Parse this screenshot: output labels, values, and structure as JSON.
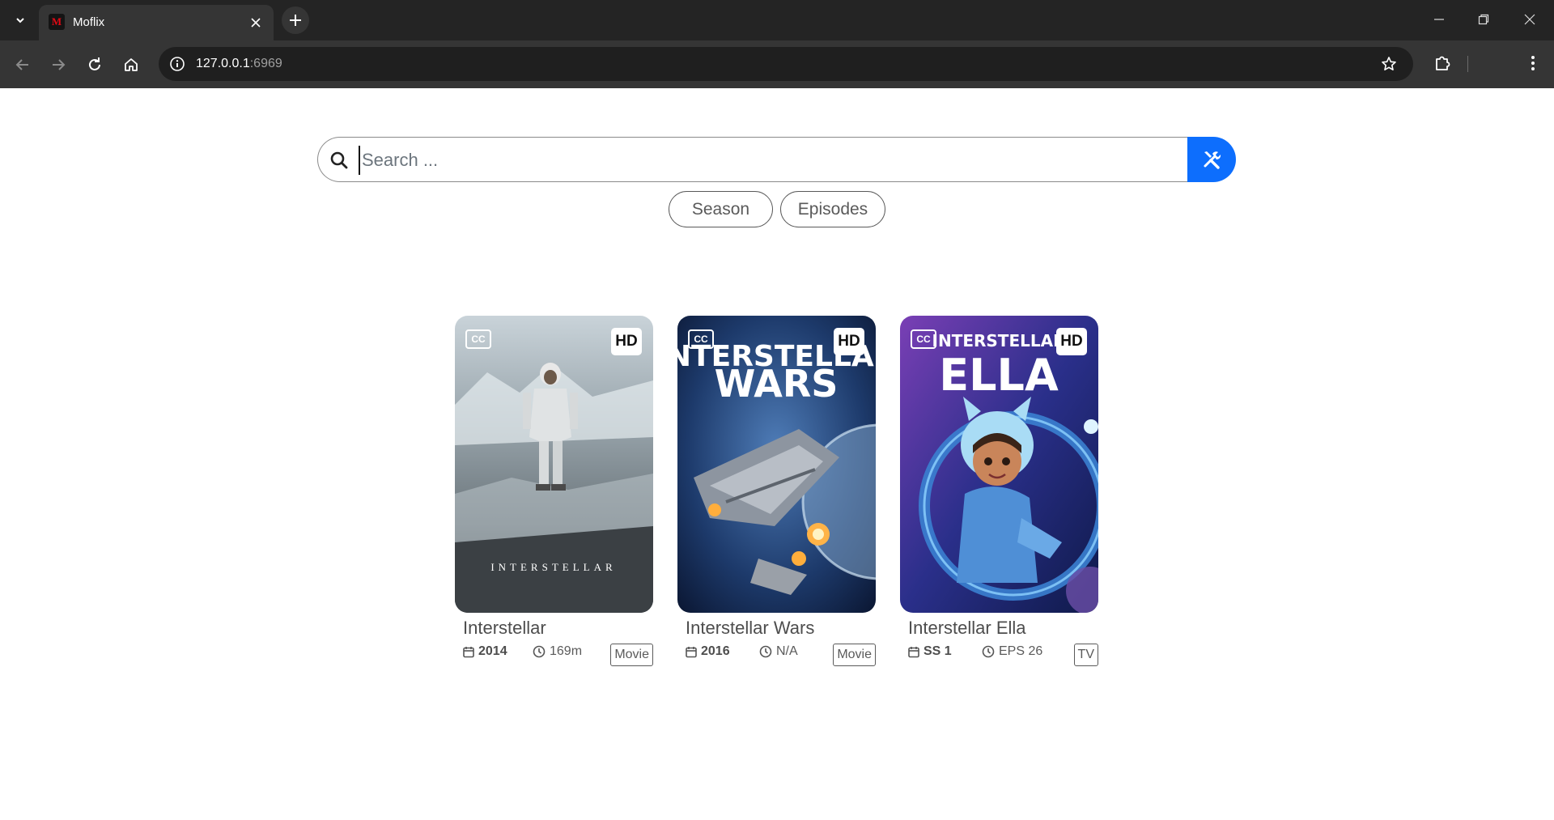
{
  "browser": {
    "tab_title": "Moflix",
    "favicon_letter": "M",
    "url_host": "127.0.0.1",
    "url_port": ":6969"
  },
  "search": {
    "placeholder": "Search ...",
    "value": ""
  },
  "filters": [
    {
      "label": "Season"
    },
    {
      "label": "Episodes"
    }
  ],
  "results": [
    {
      "title": "Interstellar",
      "year": "2014",
      "duration": "169m",
      "type": "Movie",
      "quality": "HD",
      "cc": "CC",
      "poster_title": "INTERSTELLAR",
      "poster_subtitle": ""
    },
    {
      "title": "Interstellar Wars",
      "year": "2016",
      "duration": "N/A",
      "type": "Movie",
      "quality": "HD",
      "cc": "CC",
      "poster_title": "INTERSTELLAR",
      "poster_subtitle": "WARS"
    },
    {
      "title": "Interstellar Ella",
      "year": "SS 1",
      "duration": "EPS 26",
      "type": "TV",
      "quality": "HD",
      "cc": "CC",
      "poster_title": "INTERSTELLAR",
      "poster_subtitle": "ELLA"
    }
  ],
  "colors": {
    "accent": "#0d6efd",
    "chrome_dark": "#242424",
    "chrome_toolbar": "#353535"
  }
}
